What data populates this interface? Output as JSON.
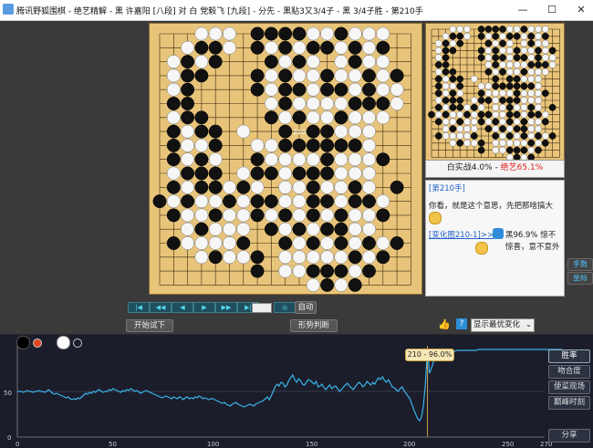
{
  "window": {
    "title": "腾讯野狐围棋 - 绝艺精解 - 黑 许嘉阳 [八段] 对 白 党毅飞 [九段] - 分先 - 黑贴3又3/4子 - 黑 3/4子胜 - 第210手",
    "minimize": "—",
    "maximize": "☐",
    "close": "✕"
  },
  "board": {
    "last_move_label": "210",
    "black": [
      [
        7,
        0
      ],
      [
        8,
        0
      ],
      [
        9,
        0
      ],
      [
        10,
        0
      ],
      [
        13,
        0
      ],
      [
        3,
        1
      ],
      [
        4,
        1
      ],
      [
        7,
        1
      ],
      [
        9,
        1
      ],
      [
        11,
        1
      ],
      [
        12,
        1
      ],
      [
        14,
        1
      ],
      [
        16,
        1
      ],
      [
        2,
        2
      ],
      [
        4,
        2
      ],
      [
        8,
        2
      ],
      [
        10,
        2
      ],
      [
        14,
        2
      ],
      [
        2,
        3
      ],
      [
        3,
        3
      ],
      [
        7,
        3
      ],
      [
        9,
        3
      ],
      [
        12,
        3
      ],
      [
        15,
        3
      ],
      [
        17,
        3
      ],
      [
        2,
        4
      ],
      [
        7,
        4
      ],
      [
        9,
        4
      ],
      [
        10,
        4
      ],
      [
        12,
        4
      ],
      [
        13,
        4
      ],
      [
        15,
        4
      ],
      [
        1,
        5
      ],
      [
        2,
        5
      ],
      [
        9,
        5
      ],
      [
        14,
        5
      ],
      [
        15,
        5
      ],
      [
        16,
        5
      ],
      [
        2,
        6
      ],
      [
        3,
        6
      ],
      [
        8,
        6
      ],
      [
        10,
        6
      ],
      [
        13,
        6
      ],
      [
        1,
        7
      ],
      [
        3,
        7
      ],
      [
        4,
        7
      ],
      [
        9,
        7
      ],
      [
        11,
        7
      ],
      [
        12,
        7
      ],
      [
        1,
        8
      ],
      [
        4,
        8
      ],
      [
        9,
        8
      ],
      [
        10,
        8
      ],
      [
        11,
        8
      ],
      [
        12,
        8
      ],
      [
        13,
        8
      ],
      [
        14,
        8
      ],
      [
        1,
        9
      ],
      [
        3,
        9
      ],
      [
        7,
        9
      ],
      [
        12,
        9
      ],
      [
        16,
        9
      ],
      [
        2,
        10
      ],
      [
        3,
        10
      ],
      [
        4,
        10
      ],
      [
        7,
        10
      ],
      [
        8,
        10
      ],
      [
        10,
        10
      ],
      [
        11,
        10
      ],
      [
        12,
        10
      ],
      [
        1,
        11
      ],
      [
        3,
        11
      ],
      [
        4,
        11
      ],
      [
        6,
        11
      ],
      [
        11,
        11
      ],
      [
        14,
        11
      ],
      [
        17,
        11
      ],
      [
        0,
        12
      ],
      [
        2,
        12
      ],
      [
        5,
        12
      ],
      [
        7,
        12
      ],
      [
        8,
        12
      ],
      [
        11,
        12
      ],
      [
        12,
        12
      ],
      [
        14,
        12
      ],
      [
        15,
        12
      ],
      [
        1,
        13
      ],
      [
        4,
        13
      ],
      [
        7,
        13
      ],
      [
        9,
        13
      ],
      [
        11,
        13
      ],
      [
        13,
        13
      ],
      [
        16,
        13
      ],
      [
        3,
        14
      ],
      [
        8,
        14
      ],
      [
        10,
        14
      ],
      [
        12,
        14
      ],
      [
        13,
        14
      ],
      [
        1,
        15
      ],
      [
        6,
        15
      ],
      [
        9,
        15
      ],
      [
        11,
        15
      ],
      [
        13,
        15
      ],
      [
        15,
        15
      ],
      [
        17,
        15
      ],
      [
        4,
        16
      ],
      [
        7,
        16
      ],
      [
        14,
        16
      ],
      [
        16,
        16
      ],
      [
        7,
        17
      ],
      [
        11,
        17
      ],
      [
        12,
        17
      ],
      [
        13,
        17
      ],
      [
        15,
        17
      ],
      [
        12,
        18
      ],
      [
        14,
        18
      ]
    ],
    "white": [
      [
        3,
        0
      ],
      [
        4,
        0
      ],
      [
        5,
        0
      ],
      [
        11,
        0
      ],
      [
        12,
        0
      ],
      [
        14,
        0
      ],
      [
        15,
        0
      ],
      [
        16,
        0
      ],
      [
        2,
        1
      ],
      [
        5,
        1
      ],
      [
        8,
        1
      ],
      [
        10,
        1
      ],
      [
        13,
        1
      ],
      [
        15,
        1
      ],
      [
        1,
        2
      ],
      [
        3,
        2
      ],
      [
        9,
        2
      ],
      [
        11,
        2
      ],
      [
        13,
        2
      ],
      [
        15,
        2
      ],
      [
        16,
        2
      ],
      [
        1,
        3
      ],
      [
        8,
        3
      ],
      [
        10,
        3
      ],
      [
        11,
        3
      ],
      [
        13,
        3
      ],
      [
        14,
        3
      ],
      [
        16,
        3
      ],
      [
        1,
        4
      ],
      [
        8,
        4
      ],
      [
        11,
        4
      ],
      [
        14,
        4
      ],
      [
        16,
        4
      ],
      [
        17,
        4
      ],
      [
        8,
        5
      ],
      [
        10,
        5
      ],
      [
        11,
        5
      ],
      [
        12,
        5
      ],
      [
        13,
        5
      ],
      [
        17,
        5
      ],
      [
        1,
        6
      ],
      [
        9,
        6
      ],
      [
        11,
        6
      ],
      [
        12,
        6
      ],
      [
        14,
        6
      ],
      [
        15,
        6
      ],
      [
        16,
        6
      ],
      [
        2,
        7
      ],
      [
        6,
        7
      ],
      [
        13,
        7
      ],
      [
        14,
        7
      ],
      [
        15,
        7
      ],
      [
        2,
        8
      ],
      [
        3,
        8
      ],
      [
        7,
        8
      ],
      [
        8,
        8
      ],
      [
        15,
        8
      ],
      [
        2,
        9
      ],
      [
        4,
        9
      ],
      [
        8,
        9
      ],
      [
        9,
        9
      ],
      [
        10,
        9
      ],
      [
        11,
        9
      ],
      [
        13,
        9
      ],
      [
        14,
        9
      ],
      [
        15,
        9
      ],
      [
        1,
        10
      ],
      [
        6,
        10
      ],
      [
        9,
        10
      ],
      [
        13,
        10
      ],
      [
        14,
        10
      ],
      [
        15,
        10
      ],
      [
        2,
        11
      ],
      [
        5,
        11
      ],
      [
        7,
        11
      ],
      [
        9,
        11
      ],
      [
        10,
        11
      ],
      [
        12,
        11
      ],
      [
        13,
        11
      ],
      [
        15,
        11
      ],
      [
        1,
        12
      ],
      [
        3,
        12
      ],
      [
        4,
        12
      ],
      [
        6,
        12
      ],
      [
        9,
        12
      ],
      [
        10,
        12
      ],
      [
        13,
        12
      ],
      [
        16,
        12
      ],
      [
        2,
        13
      ],
      [
        3,
        13
      ],
      [
        5,
        13
      ],
      [
        6,
        13
      ],
      [
        8,
        13
      ],
      [
        10,
        13
      ],
      [
        12,
        13
      ],
      [
        14,
        13
      ],
      [
        15,
        13
      ],
      [
        2,
        14
      ],
      [
        4,
        14
      ],
      [
        5,
        14
      ],
      [
        6,
        14
      ],
      [
        9,
        14
      ],
      [
        11,
        14
      ],
      [
        14,
        14
      ],
      [
        15,
        14
      ],
      [
        2,
        15
      ],
      [
        3,
        15
      ],
      [
        4,
        15
      ],
      [
        5,
        15
      ],
      [
        10,
        15
      ],
      [
        12,
        15
      ],
      [
        14,
        15
      ],
      [
        16,
        15
      ],
      [
        3,
        16
      ],
      [
        5,
        16
      ],
      [
        6,
        16
      ],
      [
        9,
        16
      ],
      [
        10,
        16
      ],
      [
        11,
        16
      ],
      [
        12,
        16
      ],
      [
        13,
        16
      ],
      [
        15,
        16
      ],
      [
        9,
        17
      ],
      [
        10,
        17
      ],
      [
        14,
        17
      ],
      [
        11,
        18
      ],
      [
        13,
        18
      ]
    ]
  },
  "mini": {
    "caption_prefix": "白实战4.0% - ",
    "caption_highlight": "绝艺65.1%"
  },
  "comment": {
    "heading": "[第210手]",
    "line1": "你看，就是这个意思，先把那啥搞大",
    "variation_link": "[变化图210-1]>>",
    "variation_text": "黑96.9% 惊不惊喜，意不意外"
  },
  "side_buttons": [
    "手数",
    "坐标"
  ],
  "nav_buttons": [
    "|◀",
    "◀◀",
    "◀",
    "▶",
    "▶▶",
    "▶|"
  ],
  "auto_label": "自动",
  "start_trial_label": "开始试下",
  "situation_label": "形势判断",
  "variation_select": "显示最优变化",
  "chart": {
    "tooltip": "210 - 96.0%",
    "buttons": [
      "胜率",
      "吻合度",
      "使菜现场",
      "巅峰时刻"
    ],
    "share_label": "分享",
    "y_ticks": [
      "50",
      "0"
    ],
    "x_ticks": [
      "0",
      "50",
      "100",
      "150",
      "200",
      "250",
      "270"
    ]
  },
  "chart_data": {
    "type": "line",
    "xlim": [
      0,
      270
    ],
    "ylim": [
      0,
      100
    ],
    "marker_move": 210,
    "values": [
      50,
      50,
      50,
      49,
      50,
      51,
      50,
      50,
      49,
      50,
      50,
      51,
      50,
      50,
      49,
      50,
      52,
      50,
      48,
      47,
      48,
      47,
      46,
      45,
      44,
      43,
      44,
      42,
      41,
      42,
      41,
      43,
      42,
      44,
      46,
      48,
      47,
      49,
      48,
      50,
      49,
      51,
      52,
      50,
      49,
      50,
      50,
      52,
      51,
      53,
      52,
      51,
      50,
      49,
      51,
      50,
      52,
      51,
      53,
      52,
      50,
      51,
      50,
      48,
      49,
      50,
      51,
      50,
      49,
      48,
      47,
      46,
      45,
      44,
      43,
      44,
      45,
      44,
      43,
      42,
      44,
      43,
      42,
      44,
      43,
      41,
      43,
      44,
      42,
      43,
      42,
      44,
      43,
      45,
      44,
      42,
      43,
      42,
      41,
      42,
      42,
      41,
      40,
      39,
      38,
      37,
      38,
      36,
      35,
      34,
      36,
      37,
      38,
      36,
      35,
      34,
      33,
      34,
      35,
      36,
      35,
      34,
      36,
      37,
      38,
      39,
      40,
      42,
      44,
      41,
      45,
      50,
      55,
      58,
      56,
      60,
      59,
      55,
      57,
      62,
      65,
      68,
      63,
      60,
      64,
      62,
      58,
      57,
      60,
      63,
      62,
      60,
      58,
      61,
      55,
      56,
      58,
      54,
      52,
      55,
      57,
      53,
      55,
      56,
      53,
      50,
      52,
      55,
      57,
      59,
      56,
      54,
      52,
      55,
      58,
      60,
      58,
      55,
      57,
      61,
      59,
      57,
      60,
      58,
      62,
      65,
      63,
      66,
      62,
      60,
      63,
      59,
      55,
      54,
      52,
      50,
      53,
      55,
      51,
      48,
      45,
      42,
      36,
      30,
      25,
      20,
      18,
      22,
      36,
      60,
      96,
      70,
      75,
      82,
      88,
      92,
      93,
      94,
      94,
      93,
      92,
      93,
      94,
      94,
      94,
      95,
      95,
      95,
      95,
      95,
      95,
      95,
      95,
      95,
      95,
      95,
      96,
      96,
      96,
      96,
      96,
      96,
      96,
      96,
      96,
      96,
      96,
      96,
      96,
      96,
      96,
      96,
      96,
      96,
      96,
      96,
      96,
      96,
      96,
      96,
      96,
      96,
      96,
      96,
      96,
      96,
      96,
      96,
      96,
      96,
      96,
      96,
      96,
      96,
      96,
      96,
      96,
      96,
      96,
      96
    ]
  }
}
